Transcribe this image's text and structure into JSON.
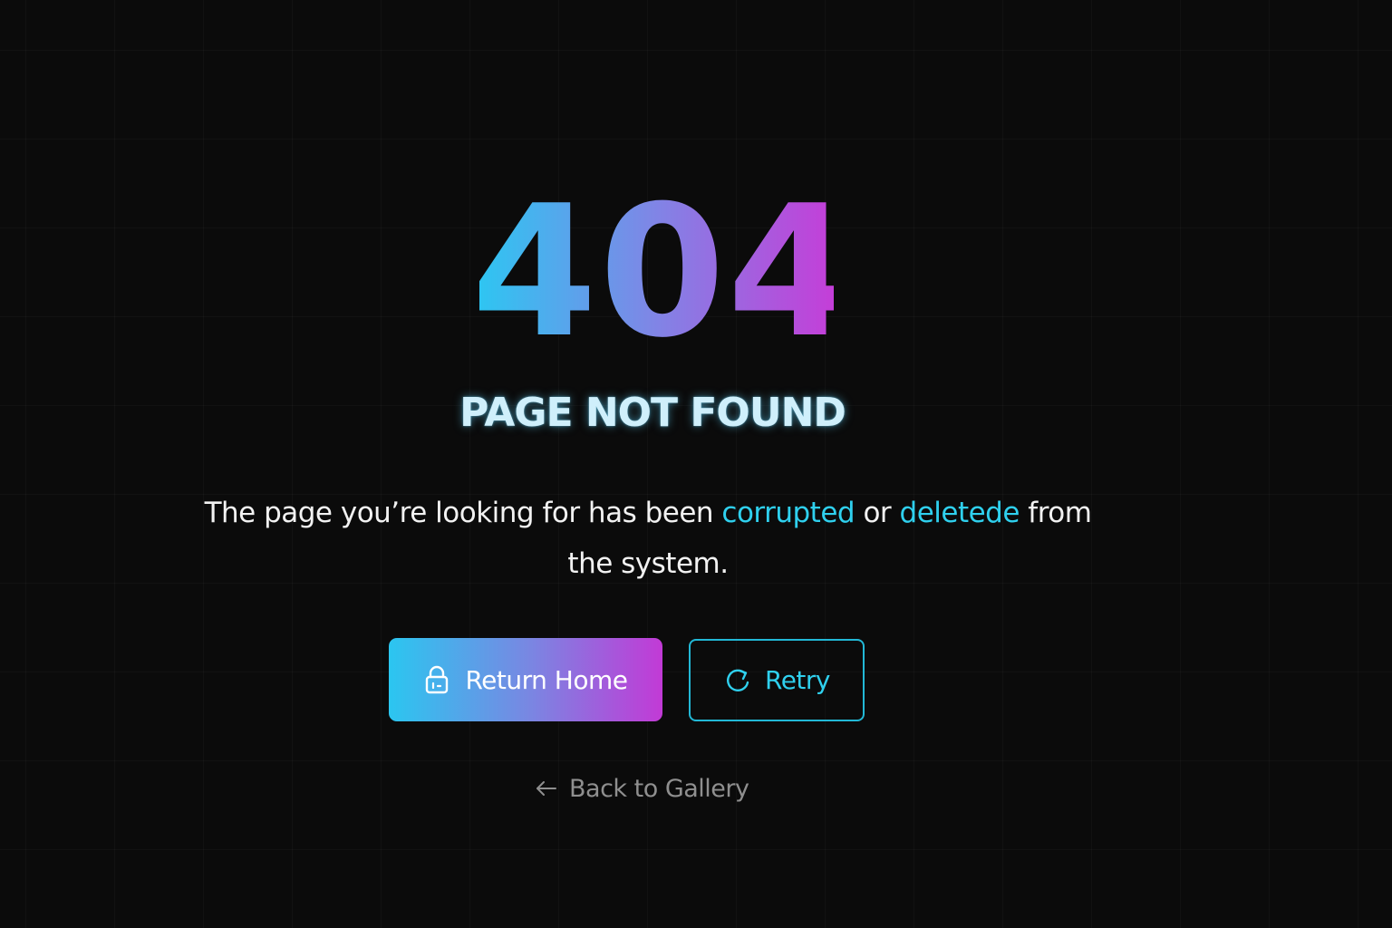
{
  "error": {
    "code": "404",
    "title": "PAGE NOT FOUND",
    "message": {
      "part1": "The page you’re looking for has been ",
      "highlight1": "corrupted",
      "part2": " or ",
      "highlight2": "deletede",
      "part3": " from the system."
    }
  },
  "actions": {
    "home_label": "Return Home",
    "home_icon": "lock-icon",
    "retry_label": "Retry",
    "retry_icon": "refresh-icon",
    "back_label": "Back to Gallery",
    "back_icon": "arrow-left-icon"
  },
  "colors": {
    "background": "#0b0b0b",
    "accent_cyan": "#2fd0ee",
    "accent_purple": "#c43ed8",
    "link_gray": "#8f8f8f"
  }
}
